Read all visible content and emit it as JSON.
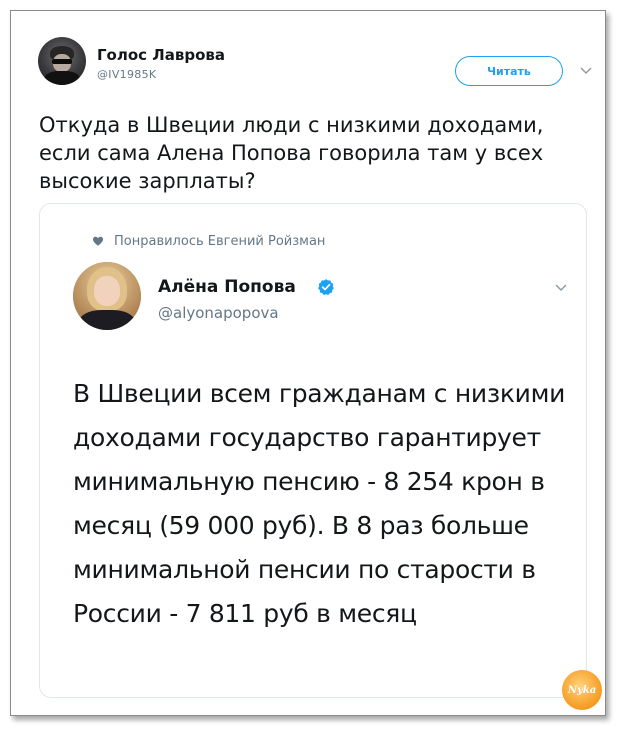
{
  "tweet": {
    "author_name": "Голос Лаврова",
    "author_handle": "@IV1985K",
    "follow_label": "Читать",
    "text": "Откуда в Швеции люди с низкими доходами, если сама Алена Попова говорила там у всех высокие зарплаты?"
  },
  "quoted": {
    "liked_by": "Понравилось Евгений Ройзман",
    "author_name": "Алёна Попова",
    "author_handle": "@alyonapopova",
    "verified": true,
    "text": "В Швеции всем гражданам с низкими доходами государство гарантирует минимальную пенсию - 8 254 крон в месяц (59 000 руб). В 8 раз больше минимальной пенсии по старости в России - 7 811 руб в месяц"
  },
  "watermark": {
    "logo_text": "Nyka"
  },
  "colors": {
    "accent": "#1da1f2",
    "text": "#14171a",
    "secondary_text": "#657786",
    "border": "#e1e8ed",
    "watermark": "#f59a1f"
  },
  "icons": [
    "heart-icon",
    "verified-icon",
    "chevron-down-icon"
  ]
}
